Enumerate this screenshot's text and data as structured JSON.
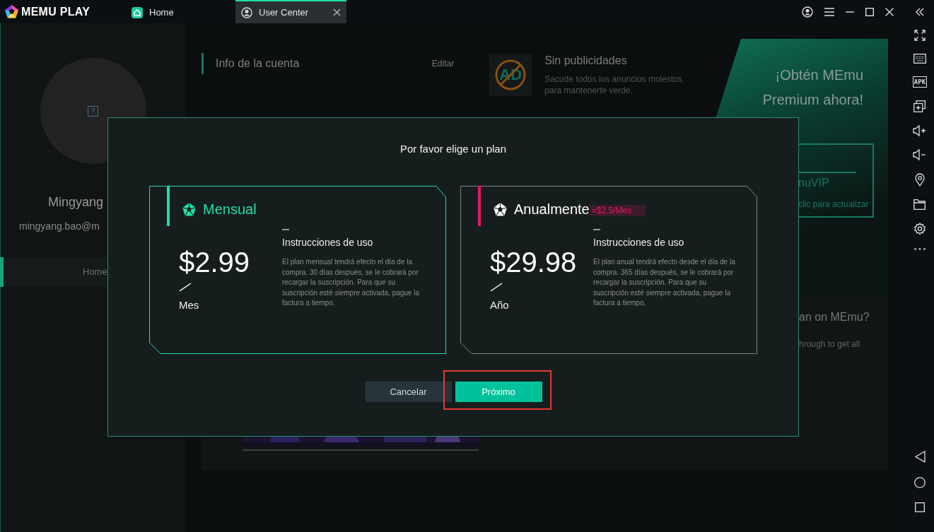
{
  "app": {
    "logo_text": "MEMU PLAY"
  },
  "tabs": [
    {
      "label": "Home",
      "kind": "home",
      "selected": false,
      "closable": false
    },
    {
      "label": "User Center",
      "kind": "user",
      "selected": true,
      "closable": true
    }
  ],
  "profile": {
    "avatar_placeholder": "?",
    "name": "Mingyang",
    "email": "mingyang.bao@m"
  },
  "nav": [
    {
      "label": "Home",
      "selected": true
    }
  ],
  "account": {
    "title": "Info de la cuenta",
    "edit": "Editar"
  },
  "feature": {
    "badge": "AD",
    "title": "Sin publicidades",
    "description": "Sacude todos los anuncios molestos para mantenerte verde."
  },
  "promo": {
    "headline_lines": [
      "¡Obtén MEmu",
      "Premium ahora!"
    ],
    "button_label": "nuVIP",
    "button_hint": "clic para actualizar"
  },
  "info_panel": {
    "title": "an on MEmu?",
    "text": "hrough to get all"
  },
  "toolbar": {
    "apk_label": "APK"
  },
  "dialog": {
    "title": "Por favor elige un plan",
    "plans": [
      {
        "name": "Mensual",
        "selected": true,
        "color": "#1de0a6",
        "price": "$2.99",
        "unit": "Mes",
        "instructions_title": "Instrucciones de uso",
        "instructions": "El plan mensual tendrá efecto el día de la compra. 30 días después, se le cobrará por recargar la suscripción. Para que su suscripción esté siempre activada, pague la factura a tiempo."
      },
      {
        "name": "Anualmente",
        "selected": false,
        "color": "#e8146c",
        "note": "=$2.5/Mes",
        "price": "$29.98",
        "unit": "Año",
        "instructions_title": "Instrucciones de uso",
        "instructions": "El plan anual tendrá efecto desde el día de la compra. 365 días después, se le cobrará por recargar la suscripción. Para que su suscripción esté siempre activada, pague la factura a tiempo."
      }
    ],
    "buttons": [
      {
        "label": "Cancelar",
        "kind": "secondary",
        "highlighted": false
      },
      {
        "label": "Próximo",
        "kind": "primary",
        "highlighted": true
      }
    ]
  }
}
